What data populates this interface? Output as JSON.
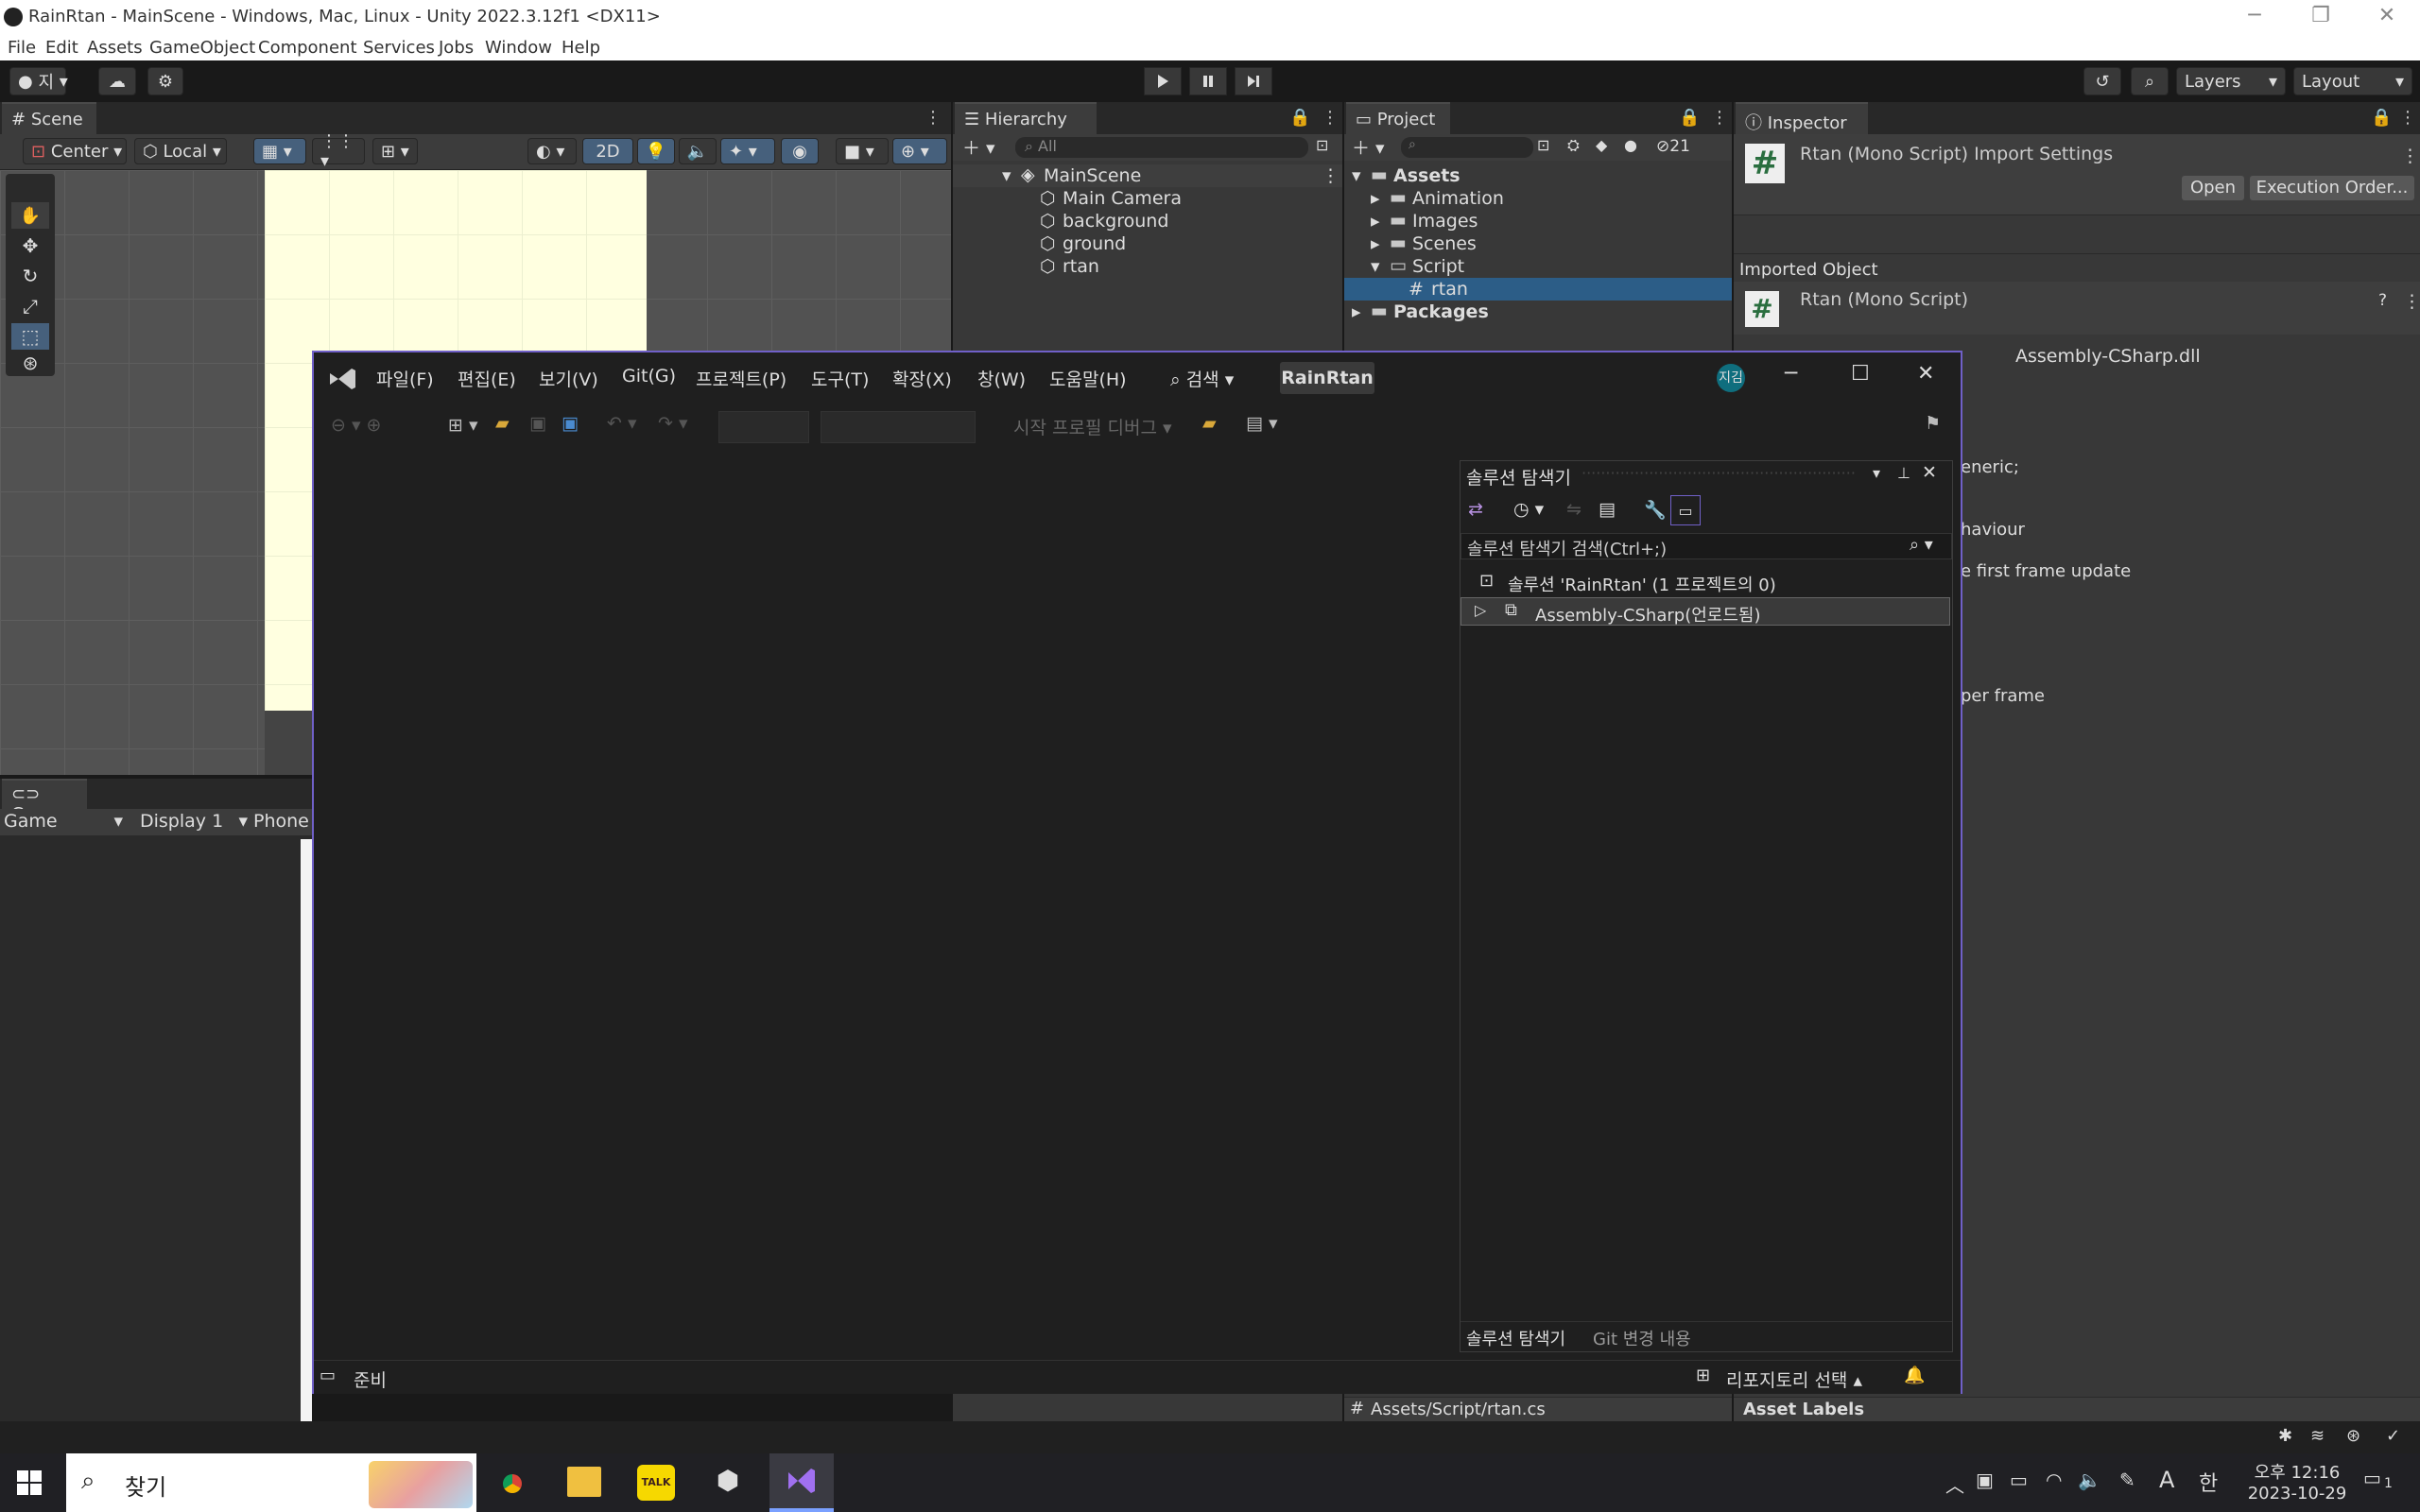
{
  "unity": {
    "title": "RainRtan - MainScene - Windows, Mac, Linux - Unity 2022.3.12f1 <DX11>",
    "menu": [
      "File",
      "Edit",
      "Assets",
      "GameObject",
      "Component",
      "Services",
      "Jobs",
      "Window",
      "Help"
    ],
    "toolbar": {
      "account": "지",
      "layers": "Layers",
      "layout": "Layout"
    },
    "scene": {
      "tab": "Scene",
      "pivot": "Center",
      "space": "Local",
      "mode2d": "2D"
    },
    "game": {
      "tab": "Game",
      "view": "Game",
      "display": "Display 1",
      "aspect": "Phone"
    },
    "hierarchy": {
      "tab": "Hierarchy",
      "search_placeholder": "All",
      "scene": "MainScene",
      "items": [
        "Main Camera",
        "background",
        "ground",
        "rtan"
      ]
    },
    "project": {
      "tab": "Project",
      "hidden_count": "21",
      "root": "Assets",
      "folders": [
        "Animation",
        "Images",
        "Scenes",
        "Script"
      ],
      "selected_file": "rtan",
      "packages": "Packages",
      "footer_path": "Assets/Script/rtan.cs"
    },
    "inspector": {
      "tab": "Inspector",
      "header": "Rtan (Mono Script) Import Settings",
      "open_button": "Open",
      "exec_button": "Execution Order...",
      "imported_label": "Imported Object",
      "object_name": "Rtan (Mono Script)",
      "assembly": "Assembly-CSharp.dll",
      "code_fragments": [
        "eneric;",
        "haviour",
        "e first frame update",
        "per frame"
      ],
      "asset_labels": "Asset Labels"
    }
  },
  "vs": {
    "menu": [
      "파일(F)",
      "편집(E)",
      "보기(V)",
      "Git(G)",
      "프로젝트(P)",
      "도구(T)",
      "확장(X)",
      "창(W)",
      "도움말(H)"
    ],
    "search": "검색",
    "solution_badge": "RainRtan",
    "user_initials": "지김",
    "start_profile": "시작 프로필 디버그",
    "solution_explorer": {
      "title": "솔루션 탐색기",
      "search": "솔루션 탐색기 검색(Ctrl+;)",
      "solution": "솔루션 'RainRtan' (1 프로젝트의 0)",
      "project": "Assembly-CSharp(언로드됨)",
      "tab1": "솔루션 탐색기",
      "tab2": "Git 변경 내용"
    },
    "status": {
      "ready": "준비",
      "repo": "리포지토리 선택"
    }
  },
  "taskbar": {
    "search": "찾기",
    "ampm": "오후",
    "time": "12:16",
    "date": "2023-10-29",
    "ime": "A",
    "ime2": "한",
    "notif": "1"
  }
}
